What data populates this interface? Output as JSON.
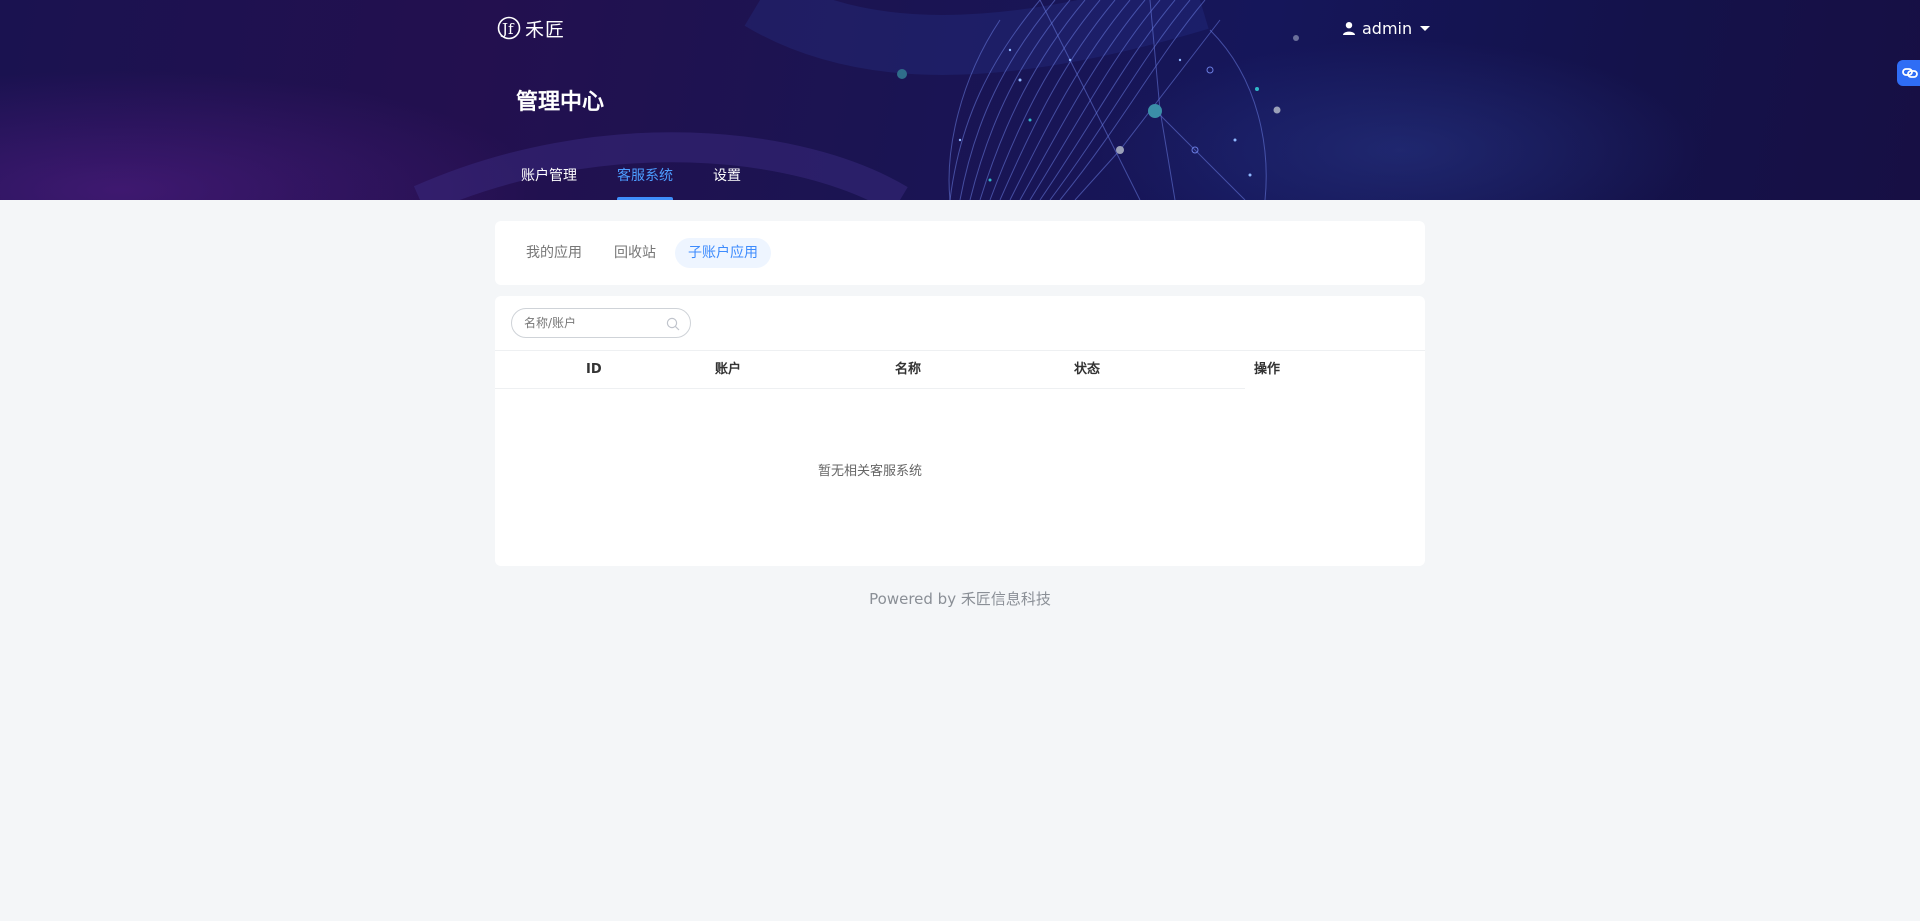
{
  "brand": {
    "logo_letters": "Jf",
    "name": "禾匠"
  },
  "user": {
    "name": "admin"
  },
  "page": {
    "title": "管理中心"
  },
  "nav": {
    "tabs": [
      {
        "label": "账户管理",
        "active": false
      },
      {
        "label": "客服系统",
        "active": true
      },
      {
        "label": "设置",
        "active": false
      }
    ]
  },
  "sub_tabs": [
    {
      "label": "我的应用",
      "active": false
    },
    {
      "label": "回收站",
      "active": false
    },
    {
      "label": "子账户应用",
      "active": true
    }
  ],
  "search": {
    "placeholder": "名称/账户",
    "value": ""
  },
  "table": {
    "columns": [
      "ID",
      "账户",
      "名称",
      "状态",
      "操作"
    ],
    "rows": [],
    "empty_text": "暂无相关客服系统"
  },
  "footer": {
    "text": "Powered by 禾匠信息科技"
  },
  "colors": {
    "accent": "#3d8bfd",
    "banner_dark": "#1a1250",
    "page_bg": "#f4f6f8",
    "float_button": "#2f6df5"
  },
  "icons": {
    "user": "user-icon",
    "caret": "chevron-down-icon",
    "search": "search-icon",
    "float": "link-icon"
  }
}
